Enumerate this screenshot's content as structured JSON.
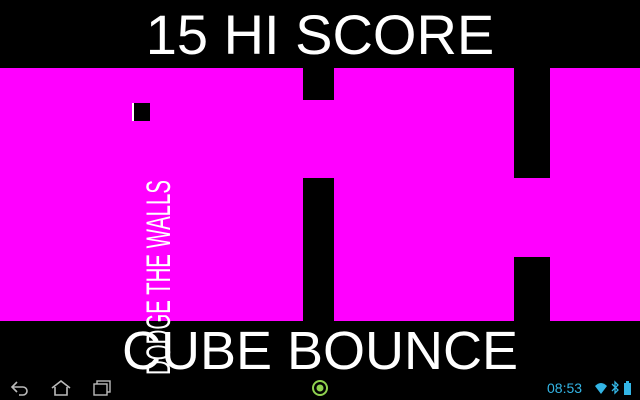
{
  "header": {
    "score_text": "15 HI SCORE"
  },
  "game": {
    "tagline": "DODGE THE WALLS",
    "title": "CUBE BOUNCE",
    "colors": {
      "playfield": "#ff00ff",
      "walls": "#000000",
      "text": "#ffffff"
    }
  },
  "system_bar": {
    "time": "08:53",
    "icons": [
      "back-icon",
      "home-icon",
      "recent-apps-icon",
      "notification-icon",
      "wifi-icon",
      "bluetooth-icon",
      "battery-icon"
    ],
    "accent": "#33b5e5"
  }
}
